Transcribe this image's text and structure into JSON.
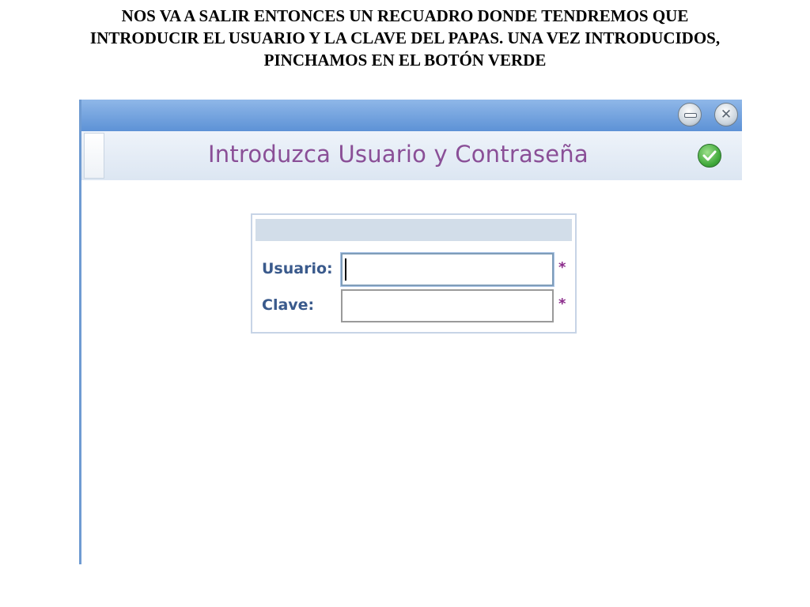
{
  "instruction": {
    "line1": "NOS VA A SALIR ENTONCES UN RECUADRO DONDE TENDREMOS QUE",
    "line2": "INTRODUCIR EL USUARIO Y LA CLAVE DEL PAPAS. UNA VEZ INTRODUCIDOS,",
    "line3": "PINCHAMOS EN EL BOTÓN VERDE"
  },
  "window": {
    "titlebar_buttons": [
      "minimize-icon",
      "close-icon"
    ],
    "close_glyph": "✕",
    "header_title": "Introduzca Usuario y Contraseña",
    "accept_icon": "check-circle-icon"
  },
  "login": {
    "usuario_label": "Usuario:",
    "usuario_value": "",
    "clave_label": "Clave:",
    "clave_value": "",
    "required_mark": "*"
  },
  "colors": {
    "title_color": "#8a4f97",
    "label_color": "#3a5a8c",
    "titlebar": "#6f9bd2",
    "accept_green": "#3fa83a"
  }
}
